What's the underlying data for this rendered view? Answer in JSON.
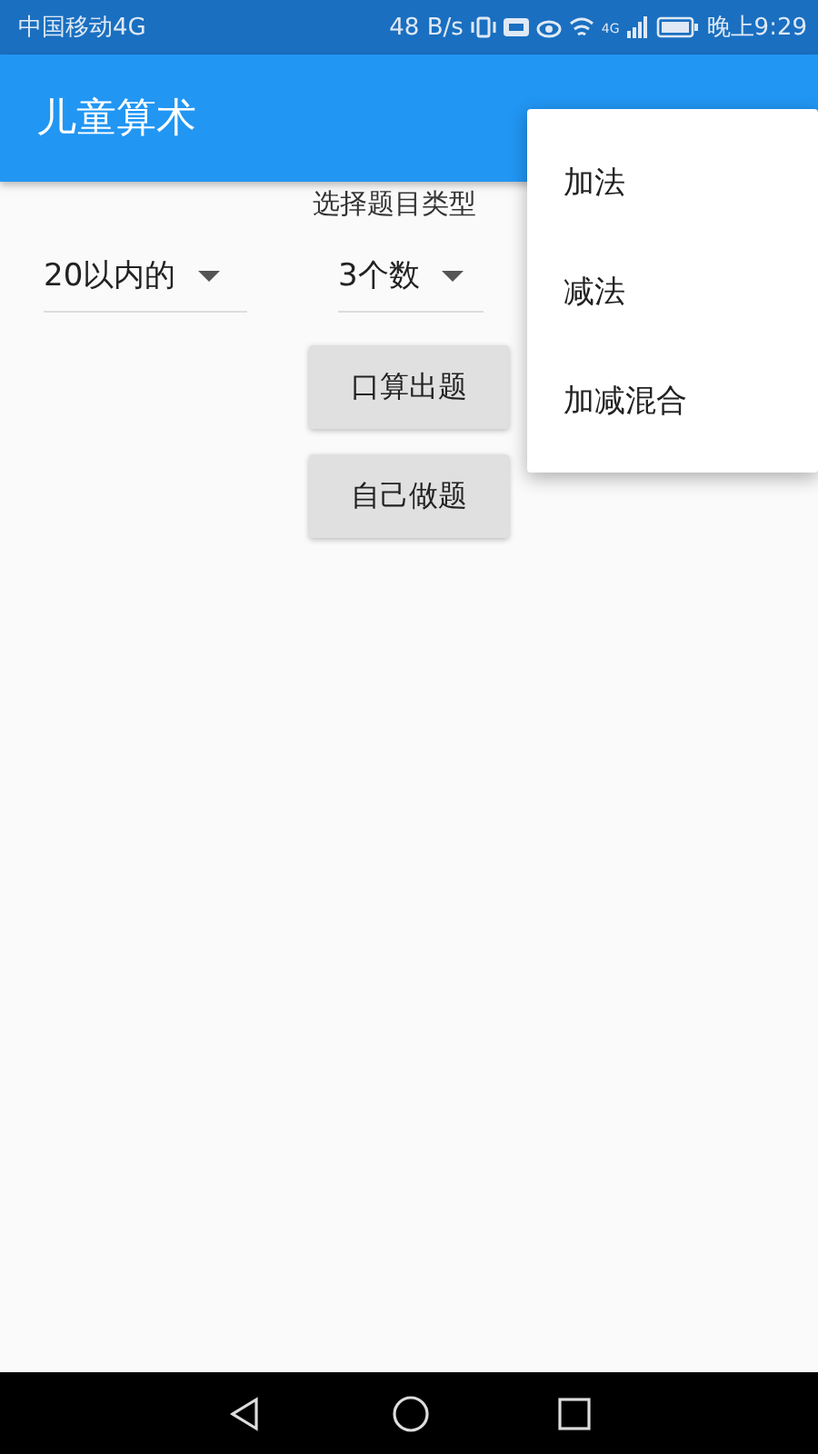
{
  "status_bar": {
    "carrier": "中国移动4G",
    "speed": "48 B/s",
    "network": "4G",
    "time": "晚上9:29"
  },
  "app_bar": {
    "title": "儿童算术"
  },
  "type_label": "选择题目类型",
  "dropdowns": [
    {
      "value": "20以内的"
    },
    {
      "value": "3个数"
    }
  ],
  "buttons": [
    "口算出题",
    "自己做题"
  ],
  "menu": [
    {
      "label": "加法"
    },
    {
      "label": "减法"
    },
    {
      "label": "加减混合"
    }
  ]
}
